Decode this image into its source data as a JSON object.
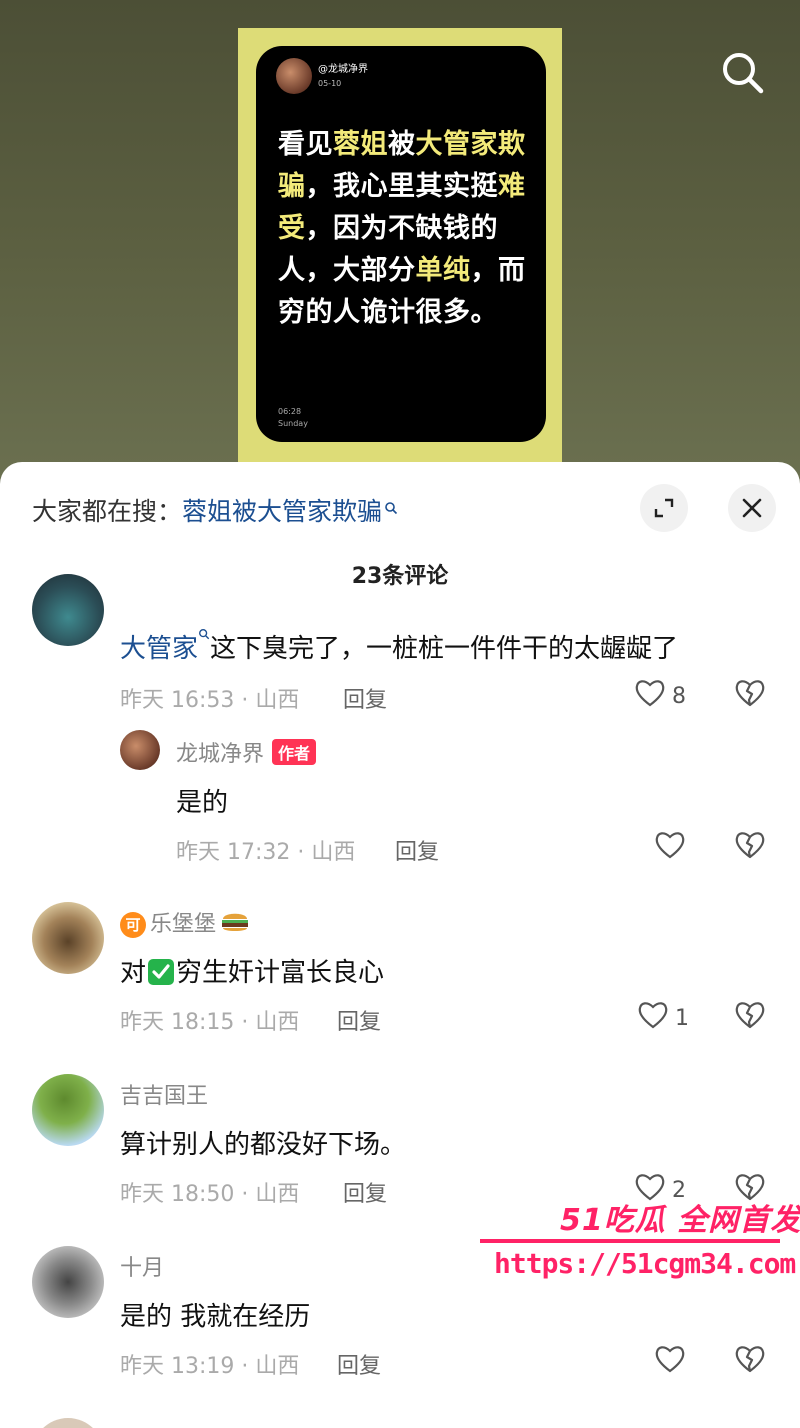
{
  "video": {
    "post": {
      "username": "@龙城净界",
      "date": "05-10",
      "text_segments": [
        {
          "t": "看见",
          "hl": false
        },
        {
          "t": "蓉姐",
          "hl": true
        },
        {
          "t": "被",
          "hl": false
        },
        {
          "t": "大管家",
          "hl": true
        },
        {
          "t": "欺骗",
          "hl": true
        },
        {
          "t": "，我心里其实挺",
          "hl": false
        },
        {
          "t": "难受",
          "hl": true
        },
        {
          "t": "，因为不缺钱的人，大部分",
          "hl": false
        },
        {
          "t": "单纯",
          "hl": true
        },
        {
          "t": "，而穷的人诡计很多。",
          "hl": false
        }
      ],
      "time": "06:28",
      "day": "Sunday"
    },
    "search_icon": "search-icon"
  },
  "sheet": {
    "search_prefix": "大家都在搜：",
    "search_term": "蓉姐被大管家欺骗",
    "expand_icon": "expand-icon",
    "close_icon": "close-icon",
    "comment_count": "23条评论"
  },
  "comments": [
    {
      "mention": "大管家",
      "text": "这下臭完了，一桩桩一件件干的太龌龊了",
      "time_loc": "昨天 16:53 · 山西",
      "reply": "回复",
      "likes": "8"
    },
    {
      "name": "龙城净界",
      "author_tag": "作者",
      "text": "是的",
      "time_loc": "昨天 17:32 · 山西",
      "reply": "回复",
      "likes": ""
    },
    {
      "badge": "可",
      "name": "乐堡堡",
      "text_before": "对",
      "text_after": "穷生奸计富长良心",
      "time_loc": "昨天 18:15 · 山西",
      "reply": "回复",
      "likes": "1"
    },
    {
      "name": "吉吉国王",
      "text": "算计别人的都没好下场。",
      "time_loc": "昨天 18:50 · 山西",
      "reply": "回复",
      "likes": "2"
    },
    {
      "name": "十月",
      "text": "是的 我就在经历",
      "time_loc": "昨天 13:19 · 山西",
      "reply": "回复",
      "likes": ""
    }
  ],
  "watermark": {
    "title": "51吃瓜 全网首发",
    "url": "https://51cgm34.com"
  },
  "colors": {
    "accent_blue": "#1c4f91",
    "author_red": "#ff3355",
    "highlight_yellow": "#f3ea7a",
    "watermark_pink": "#ff2266"
  }
}
